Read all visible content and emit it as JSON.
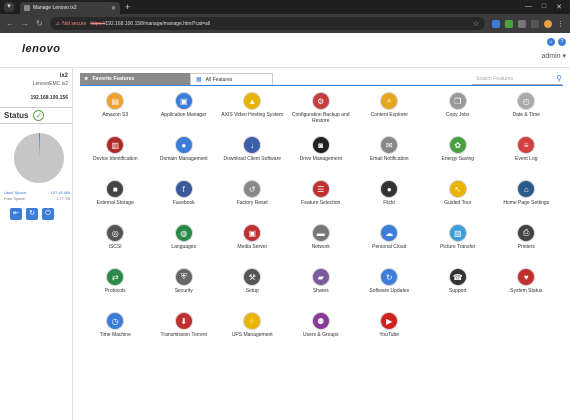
{
  "browser": {
    "tab_title": "Manage Lenovo ix2",
    "not_secure": "Not secure",
    "url_scheme": "https://",
    "url_rest": "192.168.100.158/manage/manage.html?cat=all"
  },
  "header": {
    "logo": "lenovo",
    "user": "admin ▾"
  },
  "sidebar": {
    "device_name": "ix2",
    "model": "LenovoEMC ix2",
    "ip": "192.168.100.156",
    "status_label": "Status",
    "used_label": "Used Space:",
    "used_value": "197.45 MB",
    "free_label": "Free Space:",
    "free_value": "1.77 TB",
    "used_fraction": 0.0001
  },
  "tabs": {
    "favorite": "Favorite Features",
    "all": "All Features"
  },
  "search": {
    "placeholder": "Search Features"
  },
  "features": [
    {
      "label": "Amazon S3",
      "icon": "amazon-s3",
      "color": "#f0a030",
      "glyph": "▤"
    },
    {
      "label": "Application Manager",
      "icon": "app-manager",
      "color": "#3b7dd8",
      "glyph": "▣"
    },
    {
      "label": "AXIS Video Hosting System",
      "icon": "axis",
      "color": "#e8b400",
      "glyph": "▲"
    },
    {
      "label": "Configuration Backup and Restore",
      "icon": "config-backup",
      "color": "#c24040",
      "glyph": "⚙"
    },
    {
      "label": "Content Explorer",
      "icon": "content-explorer",
      "color": "#e6a520",
      "glyph": "⌕"
    },
    {
      "label": "Copy Jobs",
      "icon": "copy-jobs",
      "color": "#999999",
      "glyph": "❐"
    },
    {
      "label": "Date & Time",
      "icon": "date-time",
      "color": "#aaaaaa",
      "glyph": "◴"
    },
    {
      "label": "Device Identification",
      "icon": "device-id",
      "color": "#b02a2a",
      "glyph": "▥"
    },
    {
      "label": "Domain Management",
      "icon": "domain",
      "color": "#3b7dd8",
      "glyph": "●"
    },
    {
      "label": "Download Client Software",
      "icon": "download-client",
      "color": "#3b5fa8",
      "glyph": "↓"
    },
    {
      "label": "Drive Management",
      "icon": "drive",
      "color": "#222222",
      "glyph": "◙"
    },
    {
      "label": "Email Notification",
      "icon": "email",
      "color": "#888888",
      "glyph": "✉"
    },
    {
      "label": "Energy Saving",
      "icon": "energy",
      "color": "#4aa040",
      "glyph": "✿"
    },
    {
      "label": "Event Log",
      "icon": "event-log",
      "color": "#d04040",
      "glyph": "≡"
    },
    {
      "label": "External Storage",
      "icon": "external-storage",
      "color": "#444444",
      "glyph": "■"
    },
    {
      "label": "Facebook",
      "icon": "facebook",
      "color": "#3b5998",
      "glyph": "f"
    },
    {
      "label": "Factory Reset",
      "icon": "factory-reset",
      "color": "#888888",
      "glyph": "↺"
    },
    {
      "label": "Feature Selection",
      "icon": "feature-selection",
      "color": "#c03030",
      "glyph": "☰"
    },
    {
      "label": "Flickr",
      "icon": "flickr",
      "color": "#333333",
      "glyph": "●"
    },
    {
      "label": "Guided Tour",
      "icon": "guided-tour",
      "color": "#e8b400",
      "glyph": "↖"
    },
    {
      "label": "Home Page Settings",
      "icon": "home-page",
      "color": "#2a5a8a",
      "glyph": "⌂"
    },
    {
      "label": "iSCSI",
      "icon": "iscsi",
      "color": "#555555",
      "glyph": "◎"
    },
    {
      "label": "Languages",
      "icon": "languages",
      "color": "#2a8a4a",
      "glyph": "◍"
    },
    {
      "label": "Media Server",
      "icon": "media-server",
      "color": "#c03030",
      "glyph": "▣"
    },
    {
      "label": "Network",
      "icon": "network",
      "color": "#777777",
      "glyph": "▬"
    },
    {
      "label": "Personal Cloud",
      "icon": "personal-cloud",
      "color": "#3b7dd8",
      "glyph": "☁"
    },
    {
      "label": "Picture Transfer",
      "icon": "picture-transfer",
      "color": "#3b9fd8",
      "glyph": "▨"
    },
    {
      "label": "Printers",
      "icon": "printers",
      "color": "#444444",
      "glyph": "⎙"
    },
    {
      "label": "Protocols",
      "icon": "protocols",
      "color": "#2a8a4a",
      "glyph": "⇄"
    },
    {
      "label": "Security",
      "icon": "security",
      "color": "#666666",
      "glyph": "⛨"
    },
    {
      "label": "Setup",
      "icon": "setup",
      "color": "#555555",
      "glyph": "⚒"
    },
    {
      "label": "Shares",
      "icon": "shares",
      "color": "#7a5a9a",
      "glyph": "▰"
    },
    {
      "label": "Software Updates",
      "icon": "software-updates",
      "color": "#3b7dd8",
      "glyph": "↻"
    },
    {
      "label": "Support",
      "icon": "support",
      "color": "#333333",
      "glyph": "☎"
    },
    {
      "label": "System Status",
      "icon": "system-status",
      "color": "#c03030",
      "glyph": "♥"
    },
    {
      "label": "Time Machine",
      "icon": "time-machine",
      "color": "#3b7dd8",
      "glyph": "◷"
    },
    {
      "label": "Transmission Torrent",
      "icon": "torrent",
      "color": "#c03030",
      "glyph": "⬇"
    },
    {
      "label": "UPS Management",
      "icon": "ups",
      "color": "#e8b400",
      "glyph": "⚡"
    },
    {
      "label": "Users & Groups",
      "icon": "users-groups",
      "color": "#8a3a9a",
      "glyph": "⚉"
    },
    {
      "label": "YouTube",
      "icon": "youtube",
      "color": "#d02020",
      "glyph": "▶"
    }
  ]
}
